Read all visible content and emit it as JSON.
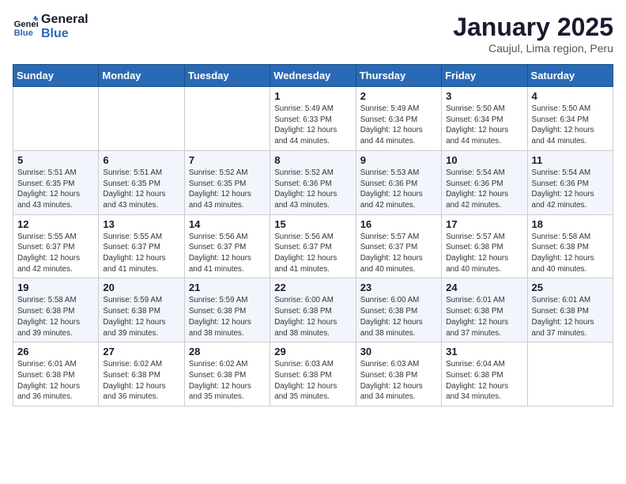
{
  "header": {
    "logo_line1": "General",
    "logo_line2": "Blue",
    "month_title": "January 2025",
    "subtitle": "Caujul, Lima region, Peru"
  },
  "days_of_week": [
    "Sunday",
    "Monday",
    "Tuesday",
    "Wednesday",
    "Thursday",
    "Friday",
    "Saturday"
  ],
  "weeks": [
    [
      {
        "day": "",
        "info": ""
      },
      {
        "day": "",
        "info": ""
      },
      {
        "day": "",
        "info": ""
      },
      {
        "day": "1",
        "info": "Sunrise: 5:49 AM\nSunset: 6:33 PM\nDaylight: 12 hours\nand 44 minutes."
      },
      {
        "day": "2",
        "info": "Sunrise: 5:49 AM\nSunset: 6:34 PM\nDaylight: 12 hours\nand 44 minutes."
      },
      {
        "day": "3",
        "info": "Sunrise: 5:50 AM\nSunset: 6:34 PM\nDaylight: 12 hours\nand 44 minutes."
      },
      {
        "day": "4",
        "info": "Sunrise: 5:50 AM\nSunset: 6:34 PM\nDaylight: 12 hours\nand 44 minutes."
      }
    ],
    [
      {
        "day": "5",
        "info": "Sunrise: 5:51 AM\nSunset: 6:35 PM\nDaylight: 12 hours\nand 43 minutes."
      },
      {
        "day": "6",
        "info": "Sunrise: 5:51 AM\nSunset: 6:35 PM\nDaylight: 12 hours\nand 43 minutes."
      },
      {
        "day": "7",
        "info": "Sunrise: 5:52 AM\nSunset: 6:35 PM\nDaylight: 12 hours\nand 43 minutes."
      },
      {
        "day": "8",
        "info": "Sunrise: 5:52 AM\nSunset: 6:36 PM\nDaylight: 12 hours\nand 43 minutes."
      },
      {
        "day": "9",
        "info": "Sunrise: 5:53 AM\nSunset: 6:36 PM\nDaylight: 12 hours\nand 42 minutes."
      },
      {
        "day": "10",
        "info": "Sunrise: 5:54 AM\nSunset: 6:36 PM\nDaylight: 12 hours\nand 42 minutes."
      },
      {
        "day": "11",
        "info": "Sunrise: 5:54 AM\nSunset: 6:36 PM\nDaylight: 12 hours\nand 42 minutes."
      }
    ],
    [
      {
        "day": "12",
        "info": "Sunrise: 5:55 AM\nSunset: 6:37 PM\nDaylight: 12 hours\nand 42 minutes."
      },
      {
        "day": "13",
        "info": "Sunrise: 5:55 AM\nSunset: 6:37 PM\nDaylight: 12 hours\nand 41 minutes."
      },
      {
        "day": "14",
        "info": "Sunrise: 5:56 AM\nSunset: 6:37 PM\nDaylight: 12 hours\nand 41 minutes."
      },
      {
        "day": "15",
        "info": "Sunrise: 5:56 AM\nSunset: 6:37 PM\nDaylight: 12 hours\nand 41 minutes."
      },
      {
        "day": "16",
        "info": "Sunrise: 5:57 AM\nSunset: 6:37 PM\nDaylight: 12 hours\nand 40 minutes."
      },
      {
        "day": "17",
        "info": "Sunrise: 5:57 AM\nSunset: 6:38 PM\nDaylight: 12 hours\nand 40 minutes."
      },
      {
        "day": "18",
        "info": "Sunrise: 5:58 AM\nSunset: 6:38 PM\nDaylight: 12 hours\nand 40 minutes."
      }
    ],
    [
      {
        "day": "19",
        "info": "Sunrise: 5:58 AM\nSunset: 6:38 PM\nDaylight: 12 hours\nand 39 minutes."
      },
      {
        "day": "20",
        "info": "Sunrise: 5:59 AM\nSunset: 6:38 PM\nDaylight: 12 hours\nand 39 minutes."
      },
      {
        "day": "21",
        "info": "Sunrise: 5:59 AM\nSunset: 6:38 PM\nDaylight: 12 hours\nand 38 minutes."
      },
      {
        "day": "22",
        "info": "Sunrise: 6:00 AM\nSunset: 6:38 PM\nDaylight: 12 hours\nand 38 minutes."
      },
      {
        "day": "23",
        "info": "Sunrise: 6:00 AM\nSunset: 6:38 PM\nDaylight: 12 hours\nand 38 minutes."
      },
      {
        "day": "24",
        "info": "Sunrise: 6:01 AM\nSunset: 6:38 PM\nDaylight: 12 hours\nand 37 minutes."
      },
      {
        "day": "25",
        "info": "Sunrise: 6:01 AM\nSunset: 6:38 PM\nDaylight: 12 hours\nand 37 minutes."
      }
    ],
    [
      {
        "day": "26",
        "info": "Sunrise: 6:01 AM\nSunset: 6:38 PM\nDaylight: 12 hours\nand 36 minutes."
      },
      {
        "day": "27",
        "info": "Sunrise: 6:02 AM\nSunset: 6:38 PM\nDaylight: 12 hours\nand 36 minutes."
      },
      {
        "day": "28",
        "info": "Sunrise: 6:02 AM\nSunset: 6:38 PM\nDaylight: 12 hours\nand 35 minutes."
      },
      {
        "day": "29",
        "info": "Sunrise: 6:03 AM\nSunset: 6:38 PM\nDaylight: 12 hours\nand 35 minutes."
      },
      {
        "day": "30",
        "info": "Sunrise: 6:03 AM\nSunset: 6:38 PM\nDaylight: 12 hours\nand 34 minutes."
      },
      {
        "day": "31",
        "info": "Sunrise: 6:04 AM\nSunset: 6:38 PM\nDaylight: 12 hours\nand 34 minutes."
      },
      {
        "day": "",
        "info": ""
      }
    ]
  ]
}
